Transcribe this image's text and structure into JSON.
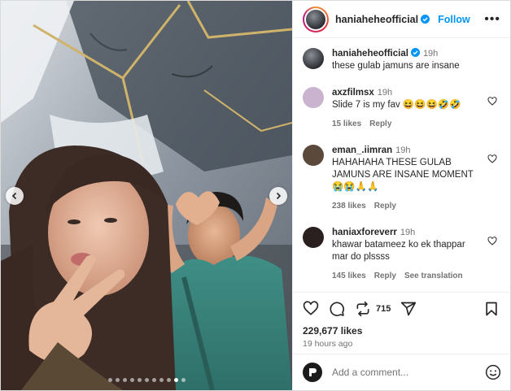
{
  "post": {
    "username": "haniaheheofficial",
    "follow_label": "Follow",
    "more_label": "•••",
    "caption": "these gulab jamuns are insane",
    "caption_time": "19h",
    "likes": "229,677 likes",
    "time_ago": "19 hours ago",
    "repost_count": "715",
    "carousel": {
      "total_slides": 11,
      "active_index": 9
    }
  },
  "comments": [
    {
      "username": "axzfilmsx",
      "time": "19h",
      "text": "Slide 7 is my fav 😆😆😆🤣🤣",
      "likes": "15 likes",
      "reply": "Reply",
      "translate": "",
      "avatar_color": "#c9b3cf"
    },
    {
      "username": "eman_.iimran",
      "time": "19h",
      "text": "HAHAHAHA THESE GULAB JAMUNS ARE INSANE MOMENT 😭😭🙏🙏",
      "likes": "238 likes",
      "reply": "Reply",
      "translate": "",
      "avatar_color": "#5b4a3c"
    },
    {
      "username": "haniaxforeverr",
      "time": "19h",
      "text": "khawar batameez ko ek thappar mar do plssss",
      "likes": "145 likes",
      "reply": "Reply",
      "translate": "See translation",
      "avatar_color": "#2a2020"
    }
  ],
  "composer": {
    "placeholder": "Add a comment..."
  },
  "colors": {
    "accent": "#0095f6",
    "muted": "#737373",
    "border": "#efefef"
  },
  "icons": [
    "chevron-left-icon",
    "chevron-right-icon",
    "verified-badge-icon",
    "more-icon",
    "heart-icon",
    "comment-icon",
    "repost-icon",
    "share-icon",
    "bookmark-icon",
    "emoji-icon"
  ]
}
